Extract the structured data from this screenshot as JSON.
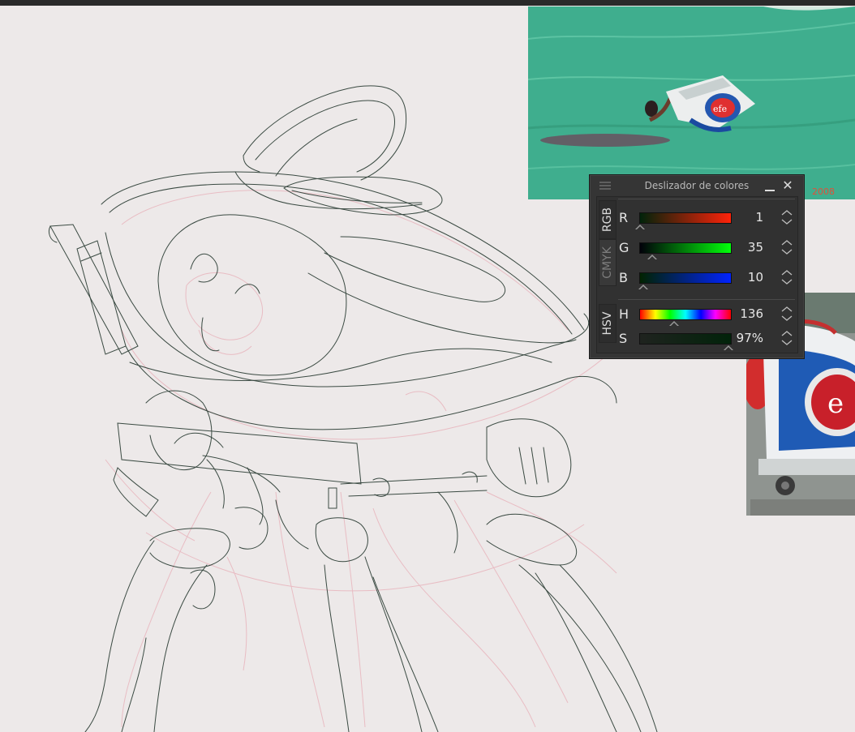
{
  "docker": {
    "title": "Deslizador de colores",
    "tabs": [
      "RGB",
      "CMYK",
      "HSV"
    ],
    "active_tab": "RGB",
    "sliders": [
      {
        "label": "R",
        "value": "1",
        "fraction": 0.004,
        "gradient": [
          "#00230a",
          "#ff230a"
        ]
      },
      {
        "label": "G",
        "value": "35",
        "fraction": 0.137,
        "gradient": [
          "#01000a",
          "#01ff0a"
        ]
      },
      {
        "label": "B",
        "value": "10",
        "fraction": 0.039,
        "gradient": [
          "#012300",
          "#0123ff"
        ]
      },
      {
        "label": "H",
        "value": "136",
        "fraction": 0.378,
        "gradient": "hue"
      },
      {
        "label": "S",
        "value": "97%",
        "fraction": 0.97,
        "gradient": [
          "#1f231f",
          "#01230a"
        ]
      }
    ]
  },
  "reference_1": {
    "logo_text": "efe",
    "watermark": "2008"
  },
  "reference_2": {
    "logo_text": "e"
  },
  "colors": {
    "canvas": "#ede9e9",
    "docker_bg": "#353535",
    "sketch_line": "#3a4a42",
    "sketch_under": "#e8b5bd"
  }
}
